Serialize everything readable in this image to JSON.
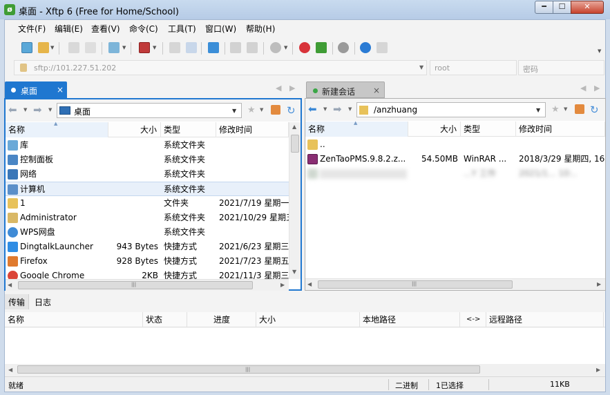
{
  "window": {
    "title": "桌面 - Xftp 6 (Free for Home/School)",
    "app_icon_glyph": "ø"
  },
  "menu": [
    "文件(F)",
    "编辑(E)",
    "查看(V)",
    "命令(C)",
    "工具(T)",
    "窗口(W)",
    "帮助(H)"
  ],
  "address": {
    "url": "sftp://101.227.51.202",
    "user_placeholder": "root",
    "password_placeholder": "密码"
  },
  "tabs": {
    "left": {
      "label": "桌面",
      "close": "×"
    },
    "right": {
      "label": "新建会话",
      "close": "×"
    }
  },
  "tab_nav": {
    "prev": "◀",
    "next": "▶",
    "close": "×"
  },
  "left_panel": {
    "path": "桌面",
    "columns": {
      "name": "名称",
      "size": "大小",
      "type": "类型",
      "modified": "修改时间"
    },
    "rows": [
      {
        "name": "库",
        "size": "",
        "type": "系统文件夹",
        "modified": "",
        "icon": "library-icon"
      },
      {
        "name": "控制面板",
        "size": "",
        "type": "系统文件夹",
        "modified": "",
        "icon": "control-panel-icon"
      },
      {
        "name": "网络",
        "size": "",
        "type": "系统文件夹",
        "modified": "",
        "icon": "network-icon"
      },
      {
        "name": "计算机",
        "size": "",
        "type": "系统文件夹",
        "modified": "",
        "icon": "computer-icon"
      },
      {
        "name": "1",
        "size": "",
        "type": "文件夹",
        "modified": "2021/7/19 星期一,",
        "icon": "folder-icon"
      },
      {
        "name": "Administrator",
        "size": "",
        "type": "系统文件夹",
        "modified": "2021/10/29 星期五",
        "icon": "user-folder-icon"
      },
      {
        "name": "WPS网盘",
        "size": "",
        "type": "系统文件夹",
        "modified": "",
        "icon": "cloud-icon"
      },
      {
        "name": "DingtalkLauncher",
        "size": "943 Bytes",
        "type": "快捷方式",
        "modified": "2021/6/23 星期三,",
        "icon": "shortcut-icon"
      },
      {
        "name": "Firefox",
        "size": "928 Bytes",
        "type": "快捷方式",
        "modified": "2021/7/23 星期五,",
        "icon": "shortcut-icon"
      },
      {
        "name": "Google Chrome",
        "size": "2KB",
        "type": "快捷方式",
        "modified": "2021/11/3 星期三",
        "icon": "shortcut-icon"
      }
    ]
  },
  "right_panel": {
    "path": "/anzhuang",
    "columns": {
      "name": "名称",
      "size": "大小",
      "type": "类型",
      "modified": "修改时间"
    },
    "rows": [
      {
        "name": "..",
        "size": "",
        "type": "",
        "modified": "",
        "icon": "folder-icon"
      },
      {
        "name": "ZenTaoPMS.9.8.2.z...",
        "size": "54.50MB",
        "type": "WinRAR ...",
        "modified": "2018/3/29 星期四, 16:..",
        "icon": "winrar-icon"
      },
      {
        "name": "",
        "size": "",
        "type": "...Y 工作",
        "modified": "2021/1... 10:..",
        "icon": "file-icon",
        "blurred": true
      }
    ]
  },
  "scroll_glyphs": {
    "up": "▲",
    "down": "▼",
    "left": "◀",
    "right": "▶",
    "grip": "|||"
  },
  "transfer": {
    "tabs": [
      "传输",
      "日志"
    ],
    "columns": [
      "名称",
      "状态",
      "进度",
      "大小",
      "本地路径",
      "<->",
      "远程路径"
    ]
  },
  "status": {
    "ready": "就绪",
    "mode": "二进制",
    "selection": "1已选择",
    "size": "11KB"
  },
  "colors": {
    "accent": "#1f77d0",
    "titlebar": "#c9dbef",
    "close": "#c7432d"
  }
}
